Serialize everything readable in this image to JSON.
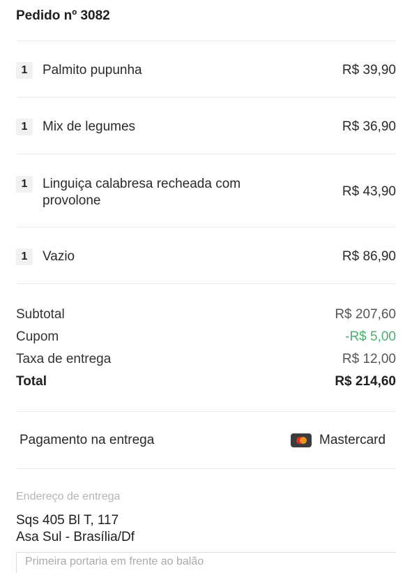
{
  "order": {
    "title": "Pedido nº 3082"
  },
  "items": [
    {
      "qty": "1",
      "name": "Palmito pupunha",
      "price": "R$ 39,90"
    },
    {
      "qty": "1",
      "name": "Mix de legumes",
      "price": "R$ 36,90"
    },
    {
      "qty": "1",
      "name": "Linguiça calabresa recheada com provolone",
      "price": "R$ 43,90"
    },
    {
      "qty": "1",
      "name": "Vazio",
      "price": "R$ 86,90"
    }
  ],
  "summary": {
    "subtotal_label": "Subtotal",
    "subtotal_value": "R$ 207,60",
    "coupon_label": "Cupom",
    "coupon_value": "-R$ 5,00",
    "delivery_label": "Taxa de entrega",
    "delivery_value": "R$ 12,00",
    "total_label": "Total",
    "total_value": "R$ 214,60"
  },
  "payment": {
    "label": "Pagamento na entrega",
    "method": "Mastercard",
    "icon": "mastercard-icon"
  },
  "address": {
    "label": "Endereço de entrega",
    "line1": "Sqs  405 Bl T, 117",
    "line2": "Asa Sul - Brasília/Df",
    "complement": "Primeira portaria em frente ao balão"
  },
  "colors": {
    "discount": "#4caf6f",
    "divider": "#ececec"
  }
}
